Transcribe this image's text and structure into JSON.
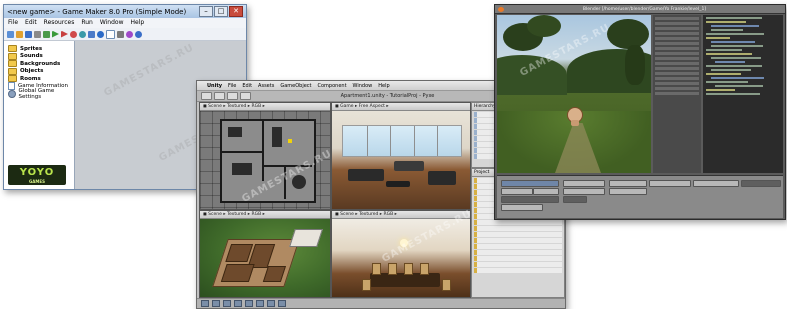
{
  "gamemaker": {
    "title": "<new game> - Game Maker 8.0 Pro (Simple Mode)",
    "menu": [
      "File",
      "Edit",
      "Resources",
      "Run",
      "Window",
      "Help"
    ],
    "tree": [
      {
        "label": "Sprites",
        "kind": "folder"
      },
      {
        "label": "Sounds",
        "kind": "folder"
      },
      {
        "label": "Backgrounds",
        "kind": "folder"
      },
      {
        "label": "Objects",
        "kind": "folder"
      },
      {
        "label": "Rooms",
        "kind": "folder"
      },
      {
        "label": "Game Information",
        "kind": "doc"
      },
      {
        "label": "Global Game Settings",
        "kind": "settings"
      }
    ],
    "logo": "YOYO",
    "logo_sub": "GAMES",
    "toolbar_colors": [
      "#5b8fd6",
      "#e0a030",
      "#4a9a4a",
      "#c84040",
      "#3a6ec8",
      "#8a8a8a",
      "#d04a4a",
      "#3a9a3a",
      "#e06a20",
      "#2a6ac8",
      "#a04ac8",
      "#3a9aa8",
      "#7a7a7a",
      "#4a7ac8"
    ]
  },
  "unity": {
    "menu": [
      "Unity",
      "File",
      "Edit",
      "Assets",
      "GameObject",
      "Component",
      "Window",
      "Help"
    ],
    "menu_right": "◼ ◉ ◷ ⊕ ⌕",
    "toolbar_title": "Apartment1.unity - TutorialProj - Pyxe",
    "views": [
      {
        "label": "◼ Scene ▸ Textured ▸ RGB ▸"
      },
      {
        "label": "◼ Game ▸ Free Aspect ▸"
      },
      {
        "label": "◼ Scene ▸ Textured ▸ RGB ▸"
      },
      {
        "label": "◼ Scene ▸ Textured ▸ RGB ▸"
      }
    ],
    "hierarchy_label": "Hierarchy",
    "project_label": "Project"
  },
  "blender": {
    "title": "Blender [/home/user/blender/Game/Yo Frankie/level_1]",
    "editor_colors": [
      "#a0b8a0",
      "#d0d080",
      "#80a0d0"
    ]
  },
  "watermarks": [
    "GAMESTARS.RU",
    "GAMESTARS.RU",
    "GAMESTARS.RU",
    "GAMESTARS.RU",
    "GAMESTARS.RU"
  ]
}
